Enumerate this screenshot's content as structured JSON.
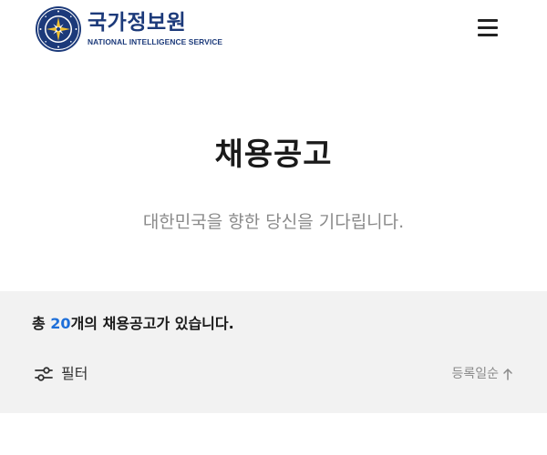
{
  "header": {
    "logo_kr": "국가정보원",
    "logo_en": "NATIONAL INTELLIGENCE SERVICE",
    "emblem_icon": "nis-emblem-icon",
    "menu_icon": "hamburger-menu-icon"
  },
  "hero": {
    "title": "채용공고",
    "subtitle": "대한민국을 향한 당신을 기다립니다."
  },
  "listing": {
    "total_prefix": "총 ",
    "total_count": "20",
    "total_suffix": "개의 채용공고가 있습니다.",
    "filter_label": "필터",
    "filter_icon": "filter-sliders-icon",
    "sort_label": "등록일순",
    "sort_icon": "arrow-up-icon"
  },
  "colors": {
    "brand": "#1c3a7a",
    "accent": "#1e6fd9",
    "panel_bg": "#f2f2f2",
    "muted_text": "#8a8a8a"
  }
}
